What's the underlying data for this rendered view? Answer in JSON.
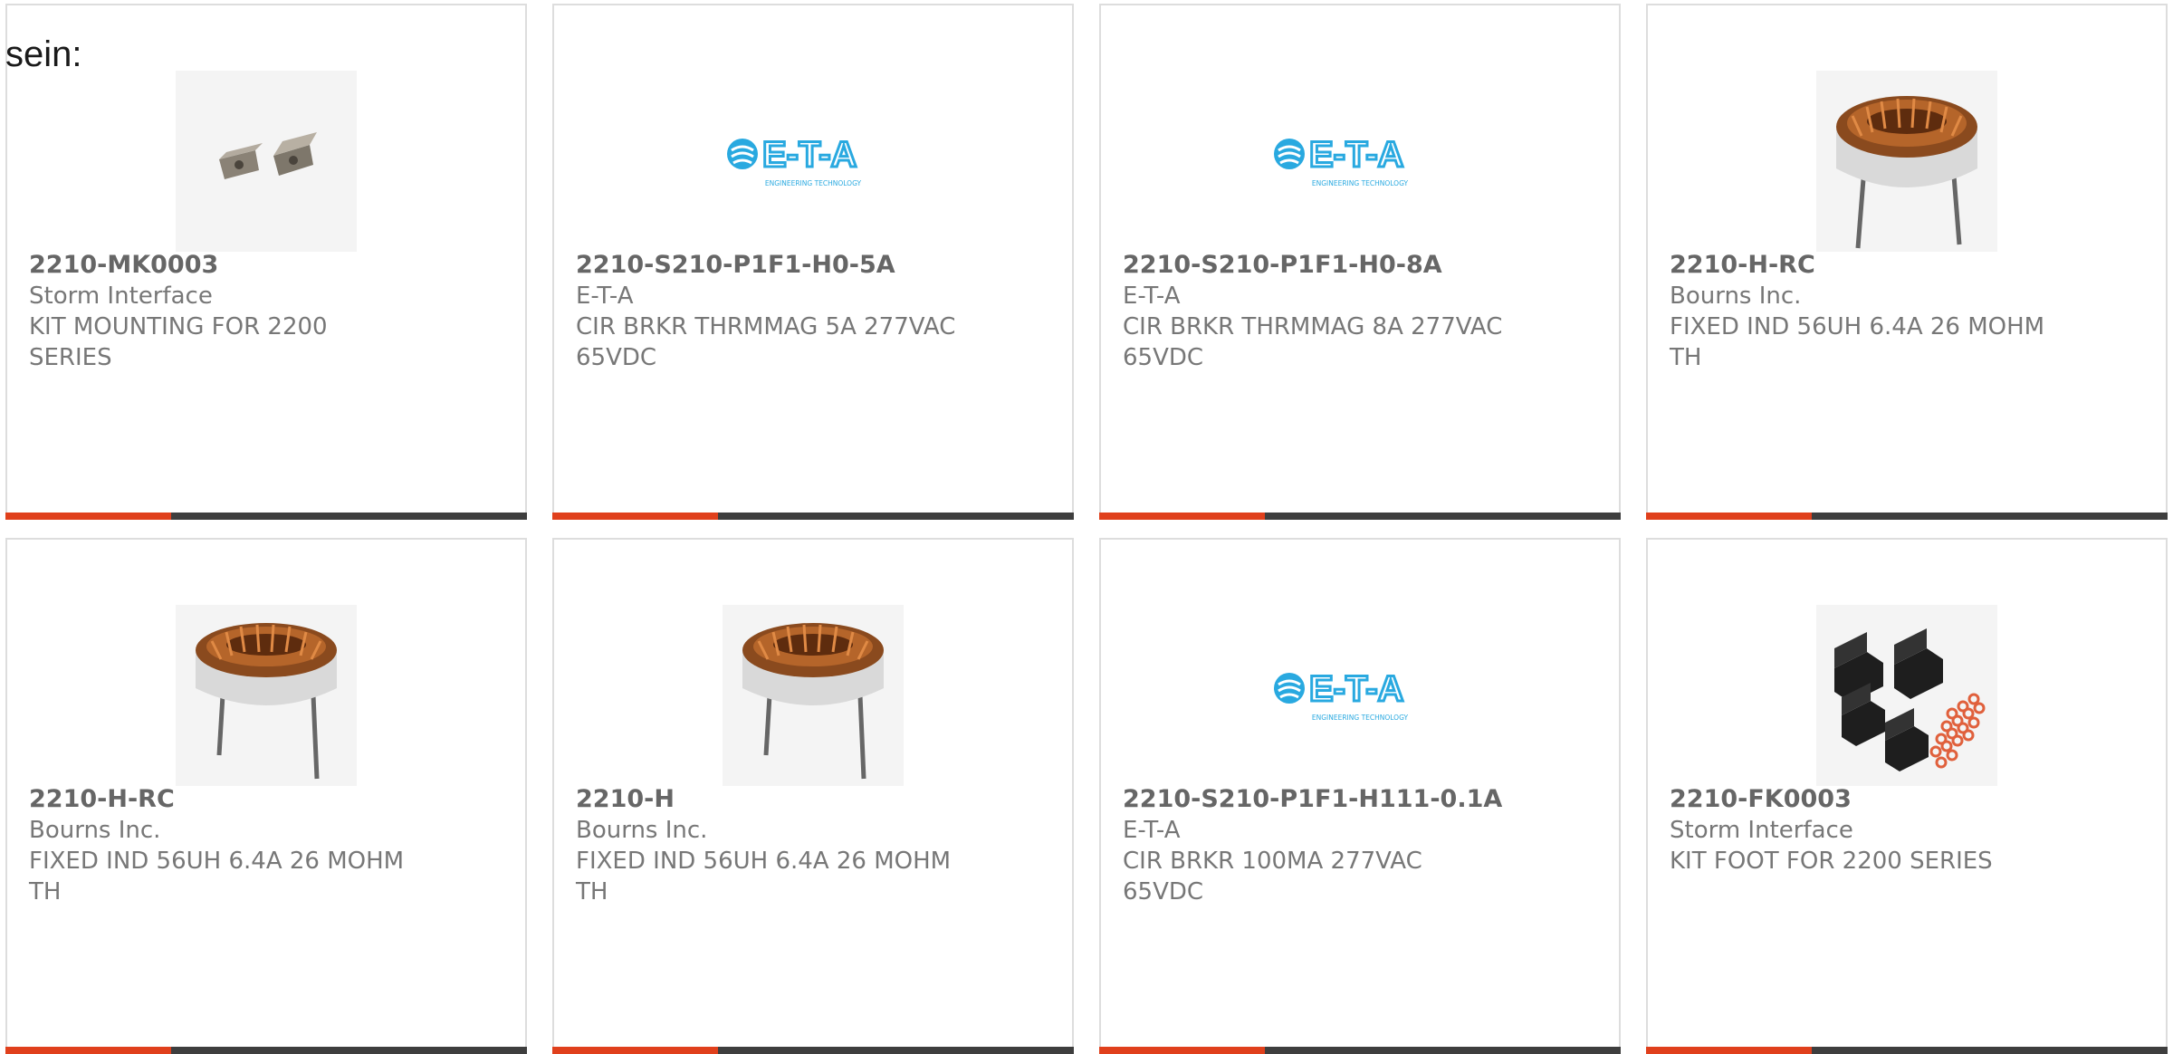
{
  "intro_text": "sein:",
  "colors": {
    "accent": "#e0401c",
    "bar": "#3e3e3e",
    "eta_blue": "#29a9e0"
  },
  "products": [
    {
      "part_number": "2210-MK0003",
      "manufacturer": "Storm Interface",
      "description": "KIT MOUNTING FOR 2200 SERIES",
      "image": "mounting-clip-icon"
    },
    {
      "part_number": "2210-S210-P1F1-H0-5A",
      "manufacturer": "E-T-A",
      "description": "CIR BRKR THRMMAG 5A 277VAC 65VDC",
      "image": "eta-logo",
      "logo_text": "E-T-A",
      "logo_tagline": "ENGINEERING TECHNOLOGY"
    },
    {
      "part_number": "2210-S210-P1F1-H0-8A",
      "manufacturer": "E-T-A",
      "description": "CIR BRKR THRMMAG 8A 277VAC 65VDC",
      "image": "eta-logo",
      "logo_text": "E-T-A",
      "logo_tagline": "ENGINEERING TECHNOLOGY"
    },
    {
      "part_number": "2210-H-RC",
      "manufacturer": "Bourns Inc.",
      "description": "FIXED IND 56UH 6.4A 26 MOHM TH",
      "image": "toroid-inductor-icon"
    },
    {
      "part_number": "2210-H-RC",
      "manufacturer": "Bourns Inc.",
      "description": "FIXED IND 56UH 6.4A 26 MOHM TH",
      "image": "toroid-inductor-icon"
    },
    {
      "part_number": "2210-H",
      "manufacturer": "Bourns Inc.",
      "description": "FIXED IND 56UH 6.4A 26 MOHM TH",
      "image": "toroid-inductor-icon"
    },
    {
      "part_number": "2210-S210-P1F1-H111-0.1A",
      "manufacturer": "E-T-A",
      "description": "CIR BRKR 100MA 277VAC 65VDC",
      "image": "eta-logo",
      "logo_text": "E-T-A",
      "logo_tagline": "ENGINEERING TECHNOLOGY"
    },
    {
      "part_number": "2210-FK0003",
      "manufacturer": "Storm Interface",
      "description": "KIT FOOT FOR 2200 SERIES",
      "image": "foot-kit-icon"
    }
  ]
}
